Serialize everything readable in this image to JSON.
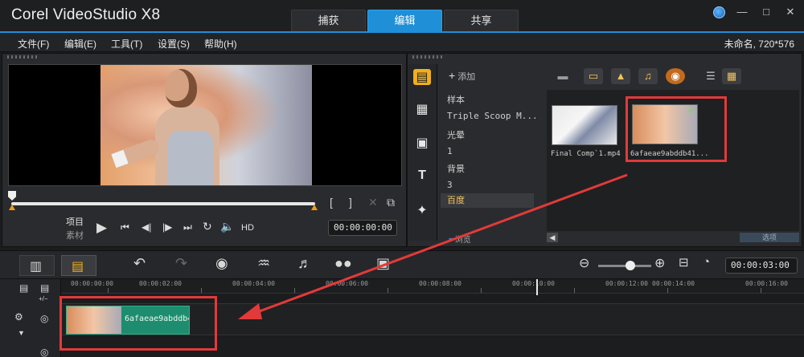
{
  "app": {
    "title": "Corel VideoStudio X8"
  },
  "mode_tabs": [
    "捕获",
    "编辑",
    "共享"
  ],
  "menu": [
    "文件(F)",
    "编辑(E)",
    "工具(T)",
    "设置(S)",
    "帮助(H)"
  ],
  "project_info": "未命名, 720*576",
  "player": {
    "mode_project": "项目",
    "mode_clip": "素材",
    "hd_label": "HD",
    "timecode": "00:00:00:00"
  },
  "library": {
    "add_label": "添加",
    "browse_label": "浏览",
    "folders": [
      "样本",
      "Triple Scoop M...",
      "光晕",
      "1",
      "背景",
      "3",
      "百度"
    ],
    "selected_folder": "百度",
    "thumbnails": [
      {
        "label": "Final Comp`1.mp4"
      },
      {
        "label": "6afaeae9abddb41..."
      }
    ],
    "options_label": "选项"
  },
  "timeline": {
    "zoom_timecode": "00:00:03:00",
    "ruler": [
      "00:00:00:00",
      "00:00:02:00",
      "00:00:04:00",
      "00:00:06:00",
      "00:00:08:00",
      "00:00:10:00",
      "00:00:12:00",
      "00:00:14:00",
      "00:00:16:00"
    ],
    "clip_name": "6afaeae9abddb41..."
  },
  "colors": {
    "accent": "#1f8fd8",
    "clip": "#1e8c6e",
    "annotation": "#e23a3a",
    "folder_selected": "#f4c45a"
  }
}
